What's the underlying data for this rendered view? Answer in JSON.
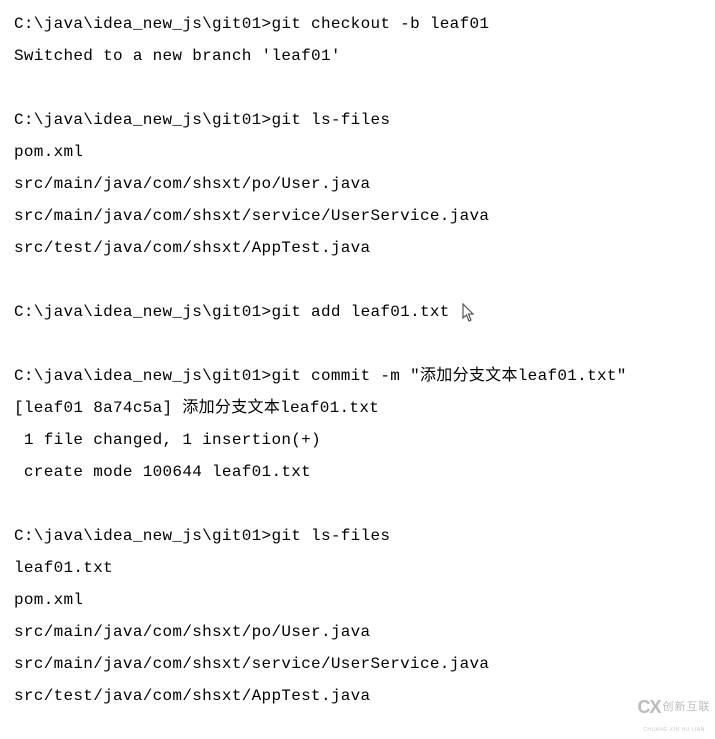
{
  "prompt": "C:\\java\\idea_new_js\\git01>",
  "lines": [
    {
      "type": "cmd",
      "text": "git checkout -b leaf01"
    },
    {
      "type": "out",
      "text": "Switched to a new branch 'leaf01'"
    },
    {
      "type": "blank"
    },
    {
      "type": "cmd",
      "text": "git ls-files"
    },
    {
      "type": "out",
      "text": "pom.xml"
    },
    {
      "type": "out",
      "text": "src/main/java/com/shsxt/po/User.java"
    },
    {
      "type": "out",
      "text": "src/main/java/com/shsxt/service/UserService.java"
    },
    {
      "type": "out",
      "text": "src/test/java/com/shsxt/AppTest.java"
    },
    {
      "type": "blank"
    },
    {
      "type": "cmd",
      "text": "git add leaf01.txt",
      "cursor": true
    },
    {
      "type": "blank"
    },
    {
      "type": "cmd",
      "text": "git commit -m \"添加分支文本leaf01.txt\""
    },
    {
      "type": "out",
      "text": "[leaf01 8a74c5a] 添加分支文本leaf01.txt"
    },
    {
      "type": "out",
      "text": " 1 file changed, 1 insertion(+)"
    },
    {
      "type": "out",
      "text": " create mode 100644 leaf01.txt"
    },
    {
      "type": "blank"
    },
    {
      "type": "cmd",
      "text": "git ls-files"
    },
    {
      "type": "out",
      "text": "leaf01.txt"
    },
    {
      "type": "out",
      "text": "pom.xml"
    },
    {
      "type": "out",
      "text": "src/main/java/com/shsxt/po/User.java"
    },
    {
      "type": "out",
      "text": "src/main/java/com/shsxt/service/UserService.java"
    },
    {
      "type": "out",
      "text": "src/test/java/com/shsxt/AppTest.java"
    }
  ],
  "watermark": {
    "logo": "CX",
    "text": "创新互联",
    "sub": "CHUANG XIN HU LIAN"
  }
}
